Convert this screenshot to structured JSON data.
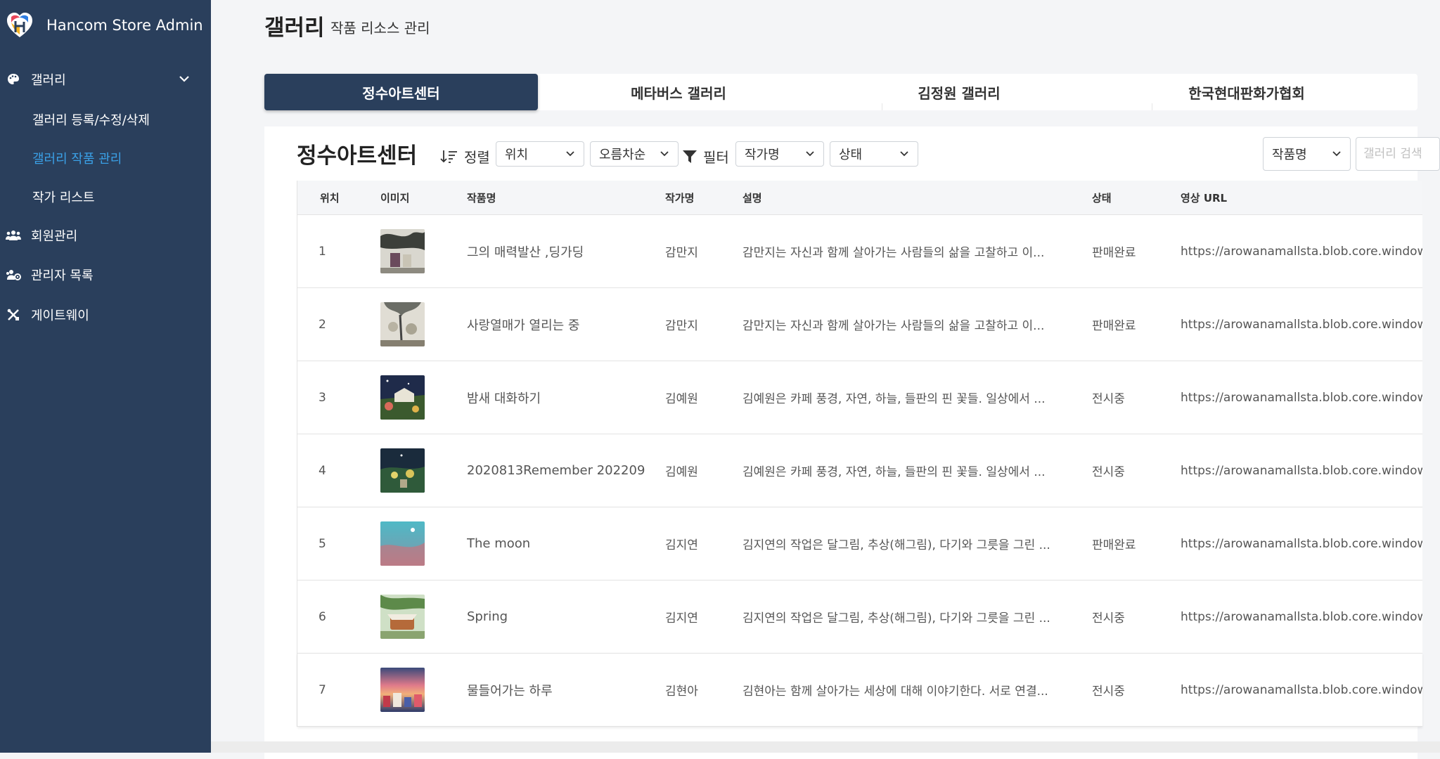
{
  "sidebar": {
    "brand": "Hancom Store Admin",
    "items": [
      {
        "label": "갤러리",
        "icon": "palette-icon"
      },
      {
        "label": "회원관리",
        "icon": "users-icon"
      },
      {
        "label": "관리자 목록",
        "icon": "admins-icon"
      },
      {
        "label": "게이트웨이",
        "icon": "tools-icon"
      }
    ],
    "subitems": [
      {
        "label": "갤러리 등록/수정/삭제",
        "active": false
      },
      {
        "label": "갤러리 작품 관리",
        "active": true
      },
      {
        "label": "작가 리스트",
        "active": false
      }
    ]
  },
  "header": {
    "title": "갤러리",
    "subtitle": "작품 리소스 관리"
  },
  "tabs": [
    "정수아트센터",
    "메타버스 갤러리",
    "김정원 갤러리",
    "한국현대판화가협회"
  ],
  "toolbar": {
    "title": "정수아트센터",
    "sort_label": "정렬",
    "sort_field": "위치",
    "sort_order": "오름차순",
    "filter_label": "필터",
    "filter_author": "작가명",
    "filter_status": "상태",
    "search_field": "작품명",
    "search_placeholder": "갤러리 검색"
  },
  "table": {
    "columns": [
      "위치",
      "이미지",
      "작품명",
      "작가명",
      "설명",
      "상태",
      "영상 URL"
    ],
    "rows": [
      {
        "pos": "1",
        "title": "그의 매력발산 ,딩가딩",
        "author": "감만지",
        "desc": "감만지는 자신과 함께 살아가는 사람들의 삶을 고찰하고 이...",
        "status": "판매완료",
        "url": "https://arowanamallsta.blob.core.window"
      },
      {
        "pos": "2",
        "title": "사랑열매가 열리는 중",
        "author": "감만지",
        "desc": "감만지는 자신과 함께 살아가는 사람들의 삶을 고찰하고 이...",
        "status": "판매완료",
        "url": "https://arowanamallsta.blob.core.window"
      },
      {
        "pos": "3",
        "title": "밤새 대화하기",
        "author": "김예원",
        "desc": "김예원은 카페 풍경, 자연, 하늘, 들판의 핀 꽃들. 일상에서 ...",
        "status": "전시중",
        "url": "https://arowanamallsta.blob.core.window"
      },
      {
        "pos": "4",
        "title": "2020813Remember 202209",
        "author": "김예원",
        "desc": "김예원은 카페 풍경, 자연, 하늘, 들판의 핀 꽃들. 일상에서 ...",
        "status": "전시중",
        "url": "https://arowanamallsta.blob.core.window"
      },
      {
        "pos": "5",
        "title": "The moon",
        "author": "김지연",
        "desc": "김지연의 작업은 달그림, 추상(해그림), 다기와 그릇을 그린 ...",
        "status": "판매완료",
        "url": "https://arowanamallsta.blob.core.window"
      },
      {
        "pos": "6",
        "title": "Spring",
        "author": "김지연",
        "desc": "김지연의 작업은 달그림, 추상(해그림), 다기와 그릇을 그린 ...",
        "status": "전시중",
        "url": "https://arowanamallsta.blob.core.window"
      },
      {
        "pos": "7",
        "title": "물들어가는 하루",
        "author": "김현아",
        "desc": "김현아는 함께 살아가는 세상에 대해 이야기한다. 서로 연결...",
        "status": "전시중",
        "url": "https://arowanamallsta.blob.core.window"
      }
    ]
  },
  "colors": {
    "sidebar": "#2a3f5c",
    "active_link": "#3aa0e6",
    "active_tab": "#2a3f5c"
  }
}
